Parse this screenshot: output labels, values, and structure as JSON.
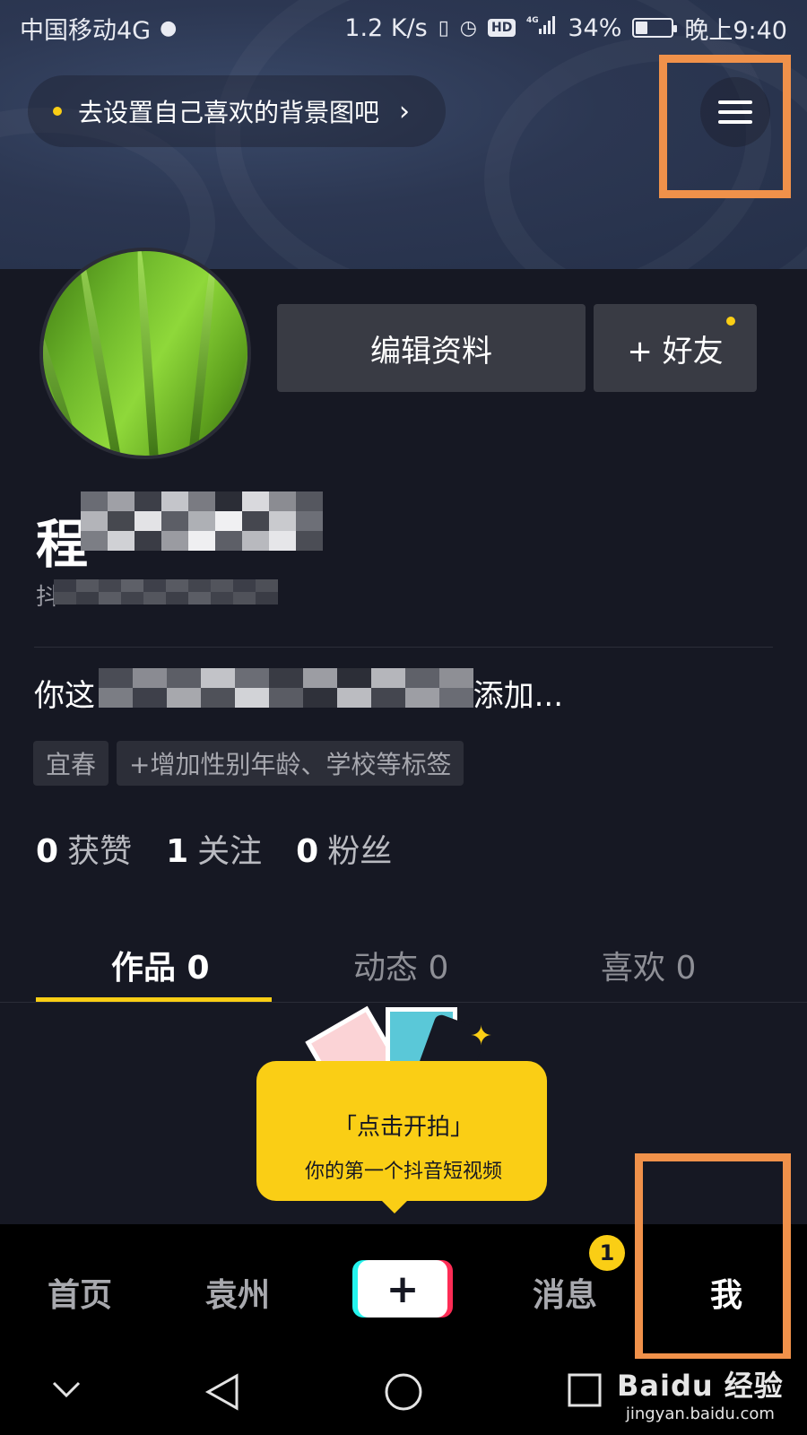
{
  "status_bar": {
    "carrier": "中国移动4G",
    "net_speed": "1.2 K/s",
    "hd_label": "HD",
    "network_label": "4G",
    "battery_percent": "34%",
    "battery_level": 0.34,
    "time": "晚上9:40",
    "icons": [
      "notification-icon",
      "vibrate-icon",
      "alarm-icon",
      "signal-icon",
      "battery-icon"
    ]
  },
  "header": {
    "background_prompt": "去设置自己喜欢的背景图吧",
    "menu_icon": "hamburger-menu-icon"
  },
  "profile": {
    "edit_button_label": "编辑资料",
    "add_friend_label": "+ 好友",
    "nickname_visible": "程",
    "douyin_id_visible": "抖",
    "bio_start": "你这",
    "bio_end": "添加...",
    "tags": [
      "宜春",
      "+增加性别年龄、学校等标签"
    ],
    "stats": [
      {
        "value": "0",
        "label": "获赞"
      },
      {
        "value": "1",
        "label": "关注"
      },
      {
        "value": "0",
        "label": "粉丝"
      }
    ]
  },
  "tabs": [
    {
      "label": "作品 0",
      "active": true
    },
    {
      "label": "动态 0",
      "active": false
    },
    {
      "label": "喜欢 0",
      "active": false
    }
  ],
  "tip": {
    "line1": "「点击开拍」",
    "line2": "你的第一个抖音短视频"
  },
  "bottom_nav": {
    "items": [
      "首页",
      "袁州",
      "+",
      "消息",
      "我"
    ],
    "active_index": 4,
    "message_badge": "1"
  },
  "system_nav": [
    "chevron-down-icon",
    "back-triangle-icon",
    "home-circle-icon",
    "recents-square-icon"
  ],
  "watermark": {
    "line1": "Baidu 经验",
    "line2": "jingyan.baidu.com"
  },
  "colors": {
    "background": "#161823",
    "accent_yellow": "#face15",
    "highlight_orange": "#f0914a",
    "button_gray": "#393b44"
  }
}
